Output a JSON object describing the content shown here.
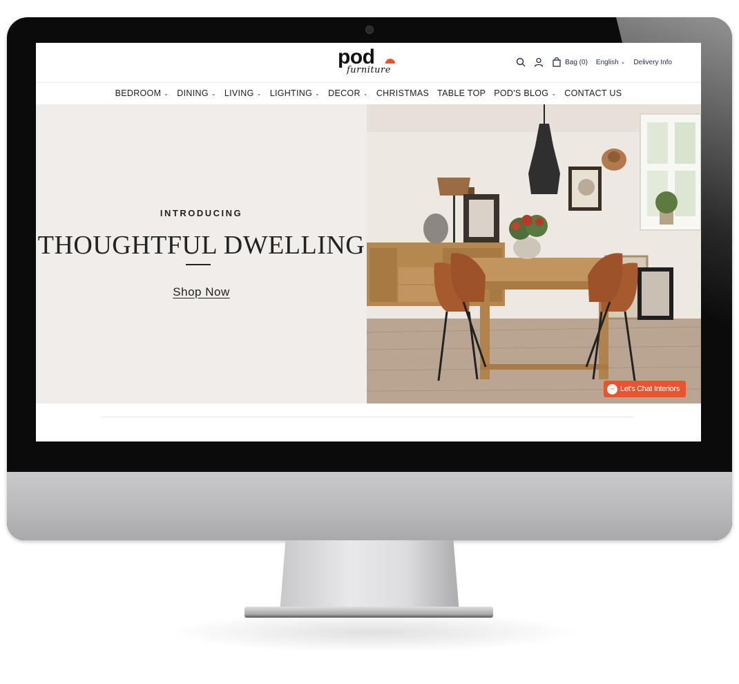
{
  "brand": {
    "name": "pod",
    "sub": "furniture",
    "accent": "#e8542f"
  },
  "header": {
    "bag_label": "Bag (0)",
    "language": "English",
    "delivery": "Delivery Info"
  },
  "nav": {
    "items": [
      {
        "label": "BEDROOM",
        "has_menu": true
      },
      {
        "label": "DINING",
        "has_menu": true
      },
      {
        "label": "LIVING",
        "has_menu": true
      },
      {
        "label": "LIGHTING",
        "has_menu": true
      },
      {
        "label": "DECOR",
        "has_menu": true
      },
      {
        "label": "CHRISTMAS",
        "has_menu": false
      },
      {
        "label": "TABLE TOP",
        "has_menu": false
      },
      {
        "label": "POD'S BLOG",
        "has_menu": true
      },
      {
        "label": "CONTACT US",
        "has_menu": false
      }
    ]
  },
  "hero": {
    "kicker": "INTRODUCING",
    "headline": "THOUGHTFUL DWELLING",
    "cta": "Shop Now",
    "background": "#f1edeb"
  },
  "chat": {
    "label": "Let's Chat Interiors",
    "color": "#e8542f"
  }
}
